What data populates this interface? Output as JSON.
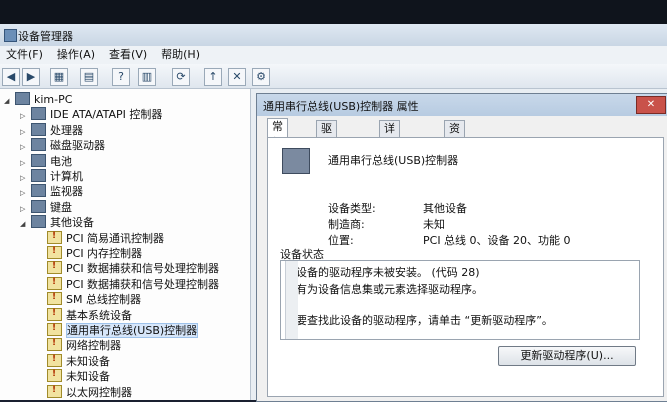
{
  "window": {
    "title": "设备管理器"
  },
  "menu": [
    "文件(F)",
    "操作(A)",
    "查看(V)",
    "帮助(H)"
  ],
  "tree": [
    {
      "label": "kim-PC",
      "expander": "◢",
      "indent": 0,
      "icon": "computer-icon"
    },
    {
      "label": "IDE ATA/ATAPI 控制器",
      "expander": "▷",
      "indent": 1,
      "icon": "ide-controller-icon"
    },
    {
      "label": "处理器",
      "expander": "▷",
      "indent": 1,
      "icon": "processor-icon"
    },
    {
      "label": "磁盘驱动器",
      "expander": "▷",
      "indent": 1,
      "icon": "disk-drive-icon"
    },
    {
      "label": "电池",
      "expander": "▷",
      "indent": 1,
      "icon": "battery-icon"
    },
    {
      "label": "计算机",
      "expander": "▷",
      "indent": 1,
      "icon": "computer-icon"
    },
    {
      "label": "监视器",
      "expander": "▷",
      "indent": 1,
      "icon": "monitor-icon"
    },
    {
      "label": "键盘",
      "expander": "▷",
      "indent": 1,
      "icon": "keyboard-icon"
    },
    {
      "label": "其他设备",
      "expander": "◢",
      "indent": 1,
      "icon": "other-devices-icon"
    },
    {
      "label": "PCI 简易通讯控制器",
      "expander": "",
      "indent": 2,
      "icon": "warning-device-icon",
      "warn": true
    },
    {
      "label": "PCI 内存控制器",
      "expander": "",
      "indent": 2,
      "icon": "warning-device-icon",
      "warn": true
    },
    {
      "label": "PCI 数据捕获和信号处理控制器",
      "expander": "",
      "indent": 2,
      "icon": "warning-device-icon",
      "warn": true
    },
    {
      "label": "PCI 数据捕获和信号处理控制器",
      "expander": "",
      "indent": 2,
      "icon": "warning-device-icon",
      "warn": true
    },
    {
      "label": "SM 总线控制器",
      "expander": "",
      "indent": 2,
      "icon": "warning-device-icon",
      "warn": true
    },
    {
      "label": "基本系统设备",
      "expander": "",
      "indent": 2,
      "icon": "warning-device-icon",
      "warn": true
    },
    {
      "label": "通用串行总线(USB)控制器",
      "expander": "",
      "indent": 2,
      "icon": "warning-device-icon",
      "warn": true,
      "selected": true
    },
    {
      "label": "网络控制器",
      "expander": "",
      "indent": 2,
      "icon": "warning-device-icon",
      "warn": true
    },
    {
      "label": "未知设备",
      "expander": "",
      "indent": 2,
      "icon": "warning-device-icon",
      "warn": true
    },
    {
      "label": "未知设备",
      "expander": "",
      "indent": 2,
      "icon": "warning-device-icon",
      "warn": true
    },
    {
      "label": "以太网控制器",
      "expander": "",
      "indent": 2,
      "icon": "warning-device-icon",
      "warn": true
    }
  ],
  "dialog": {
    "title": "通用串行总线(USB)控制器 属性",
    "close": "✕",
    "tabs": [
      "常规",
      "驱动程序",
      "详细信息",
      "资源"
    ],
    "device_name": "通用串行总线(USB)控制器",
    "props": [
      {
        "key": "设备类型:",
        "value": "其他设备"
      },
      {
        "key": "制造商:",
        "value": "未知"
      },
      {
        "key": "位置:",
        "value": "PCI 总线 0、设备 20、功能 0"
      }
    ],
    "status_group": "设备状态",
    "status_lines": [
      "该设备的驱动程序未被安装。 (代码 28)",
      "没有为设备信息集或元素选择驱动程序。",
      "",
      "若要查找此设备的驱动程序，请单击 “更新驱动程序”。"
    ],
    "update_button": "更新驱动程序(U)..."
  }
}
